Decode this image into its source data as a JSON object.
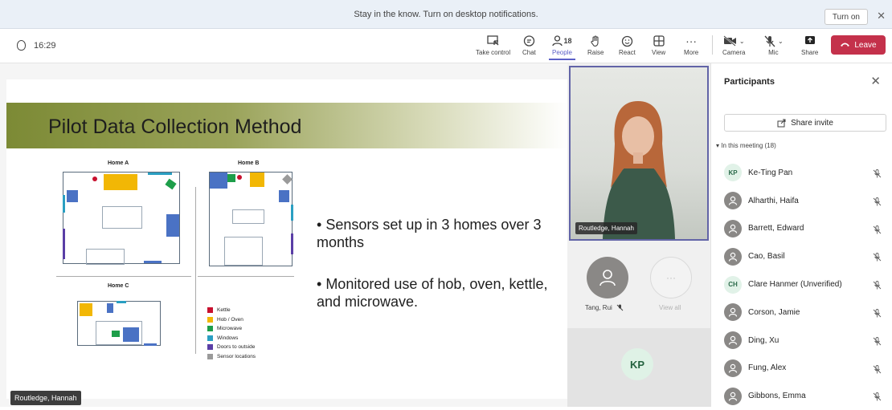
{
  "notification": {
    "text": "Stay in the know. Turn on desktop notifications.",
    "turn_on_label": "Turn on",
    "close_icon": "close-icon"
  },
  "toolbar": {
    "timer": "16:29",
    "take_control": "Take control",
    "chat": "Chat",
    "people": "People",
    "people_count": "18",
    "raise": "Raise",
    "react": "React",
    "view": "View",
    "more": "More",
    "camera": "Camera",
    "mic": "Mic",
    "share": "Share",
    "leave": "Leave",
    "leave_color": "#c4314b",
    "accent_color": "#5b5fc7"
  },
  "slide": {
    "title": "Pilot Data Collection Method",
    "home_a": "Home A",
    "home_b": "Home B",
    "home_c": "Home C",
    "legend": [
      {
        "label": "Kettle",
        "color": "#c8102e"
      },
      {
        "label": "Hob / Oven",
        "color": "#f2b705"
      },
      {
        "label": "Microwave",
        "color": "#1e9e4a"
      },
      {
        "label": "Windows",
        "color": "#2a9fc2"
      },
      {
        "label": "Doors to outside",
        "color": "#5a3ea6"
      },
      {
        "label": "Sensor locations",
        "color": "#9a9a9a"
      }
    ],
    "bullet_1": "Sensors set up in 3 homes over 3 months",
    "bullet_2": "Monitored use of hob, oven, kettle, and microwave.",
    "presenter_name": "Routledge, Hannah"
  },
  "video": {
    "main_name": "Routledge, Hannah",
    "tang_name": "Tang, Rui",
    "view_all": "View all",
    "kp_initials": "KP"
  },
  "participants": {
    "title": "Participants",
    "share_invite": "Share invite",
    "in_meeting": "In this meeting (18)",
    "list": [
      {
        "name": "Ke-Ting Pan",
        "initials": "KP"
      },
      {
        "name": "Alharthi, Haifa",
        "initials": ""
      },
      {
        "name": "Barrett, Edward",
        "initials": ""
      },
      {
        "name": "Cao, Basil",
        "initials": ""
      },
      {
        "name": "Clare Hanmer (Unverified)",
        "initials": "CH"
      },
      {
        "name": "Corson, Jamie",
        "initials": ""
      },
      {
        "name": "Ding, Xu",
        "initials": ""
      },
      {
        "name": "Fung, Alex",
        "initials": ""
      },
      {
        "name": "Gibbons, Emma",
        "initials": ""
      }
    ]
  }
}
